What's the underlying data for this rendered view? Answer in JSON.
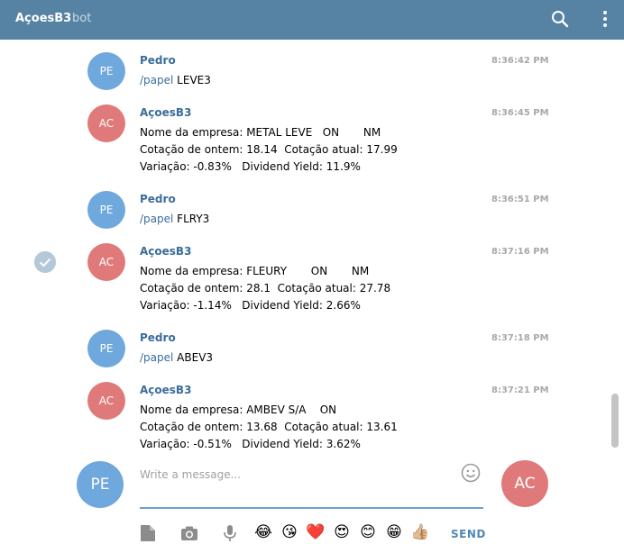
{
  "header": {
    "title": "AçoesB3",
    "subtitle": "bot",
    "search_icon": "search-icon",
    "more_icon": "more-vertical-icon",
    "bg_color": "#5682a3"
  },
  "messages": [
    {
      "avatar": "PE",
      "sender": "Pedro",
      "time": "8:36:42 PM",
      "command": "/papel",
      "arg": " LEVE3"
    },
    {
      "avatar": "AC",
      "sender": "AçoesB3",
      "time": "8:36:45 PM",
      "lines": [
        "Nome da empresa: METAL LEVE   ON       NM",
        "Cotação de ontem: 18.14  Cotação atual: 17.99",
        "Variação: -0.83%   Dividend Yield: 11.9%"
      ]
    },
    {
      "avatar": "PE",
      "sender": "Pedro",
      "time": "8:36:51 PM",
      "command": "/papel",
      "arg": " FLRY3"
    },
    {
      "avatar": "AC",
      "sender": "AçoesB3",
      "time": "8:37:16 PM",
      "lines": [
        "Nome da empresa: FLEURY       ON       NM",
        "Cotação de ontem: 28.1  Cotação atual: 27.78",
        "Variação: -1.14%   Dividend Yield: 2.66%"
      ]
    },
    {
      "avatar": "PE",
      "sender": "Pedro",
      "time": "8:37:18 PM",
      "command": "/papel",
      "arg": " ABEV3"
    },
    {
      "avatar": "AC",
      "sender": "AçoesB3",
      "time": "8:37:21 PM",
      "lines": [
        "Nome da empresa: AMBEV S/A    ON",
        "Cotação de ontem: 13.68  Cotação atual: 13.61",
        "Variação: -0.51%   Dividend Yield: 3.62%"
      ]
    }
  ],
  "composer": {
    "my_avatar": "PE",
    "their_avatar": "AC",
    "placeholder": "Write a message...",
    "send_label": "SEND",
    "emojis": [
      "😂",
      "😘",
      "❤️",
      "😍",
      "😊",
      "😁",
      "👍🏼"
    ]
  }
}
